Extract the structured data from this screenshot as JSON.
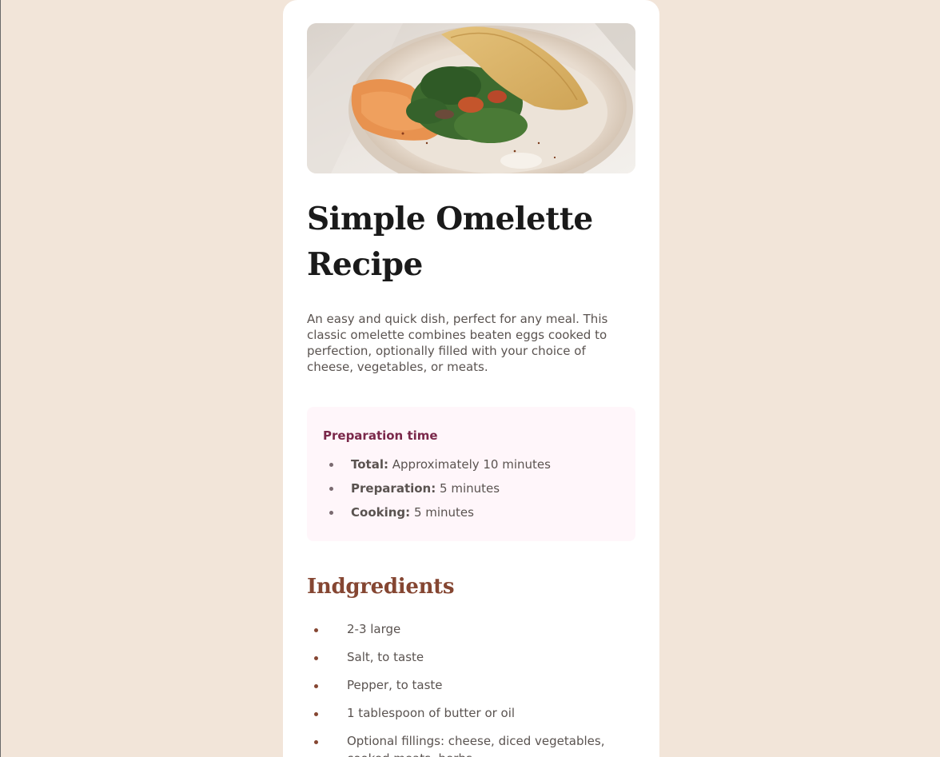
{
  "recipe": {
    "title": "Simple Omelette Recipe",
    "description": "An easy and quick dish, perfect for any meal. This classic omelette combines beaten eggs cooked to perfection, optionally filled with your choice of cheese, vegetables, or meats.",
    "image_subject": "omelette on plate with spinach"
  },
  "preparation": {
    "title": "Preparation time",
    "items": [
      {
        "label": "Total:",
        "value": "Approximately 10 minutes"
      },
      {
        "label": "Preparation:",
        "value": "5 minutes"
      },
      {
        "label": "Cooking:",
        "value": "5 minutes"
      }
    ]
  },
  "ingredients": {
    "title": "Indgredients",
    "items": [
      "2-3 large",
      "Salt, to taste",
      "Pepper, to taste",
      "1 tablespoon of butter or oil",
      "Optional fillings: cheese, diced vegetables, cooked meats, herbs"
    ]
  },
  "colors": {
    "page_background": "#f2e5d9",
    "card_background": "#ffffff",
    "prep_background": "#fff6fa",
    "prep_title": "#7a284a",
    "ingredient_accent": "#854632",
    "body_text": "#5a5350"
  }
}
